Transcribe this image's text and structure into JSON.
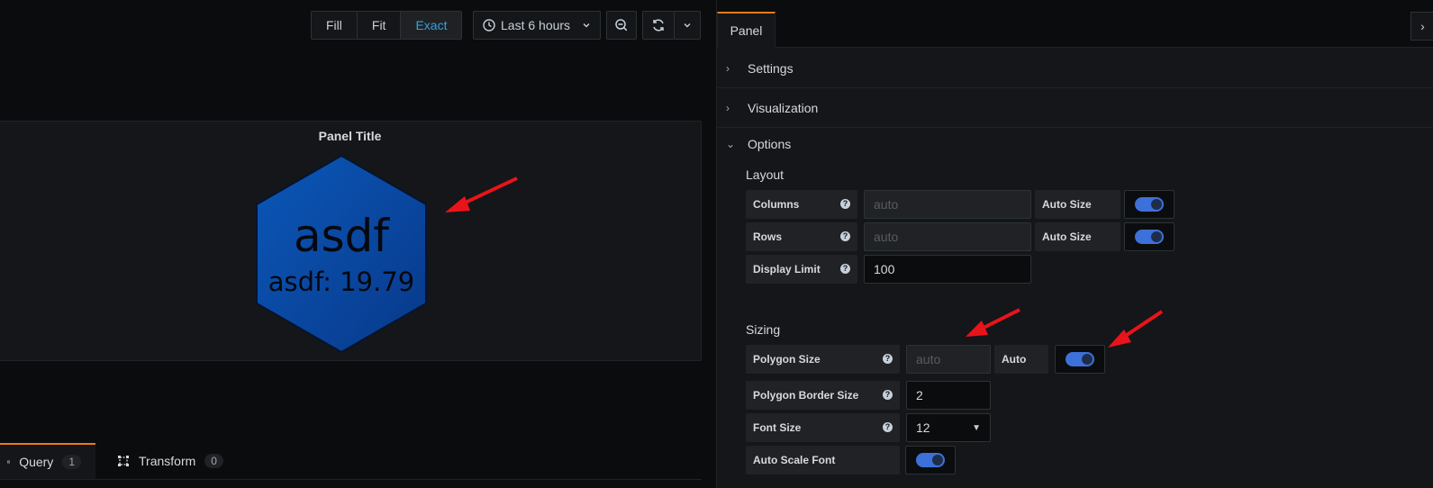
{
  "toolbar": {
    "fill_label": "Fill",
    "fit_label": "Fit",
    "exact_label": "Exact",
    "time_range": "Last 6 hours"
  },
  "panel": {
    "title": "Panel Title",
    "polygon_name": "asdf",
    "polygon_value": "asdf: 19.79",
    "polygon_color": "#0a4fa6"
  },
  "bottom_tabs": {
    "query_label": "Query",
    "query_count": "1",
    "transform_label": "Transform",
    "transform_count": "0"
  },
  "editor": {
    "tab_label": "Panel",
    "sections": {
      "settings": "Settings",
      "visualization": "Visualization",
      "options": "Options"
    },
    "layout": {
      "title": "Layout",
      "columns_label": "Columns",
      "columns_placeholder": "auto",
      "rows_label": "Rows",
      "rows_placeholder": "auto",
      "auto_size_label": "Auto Size",
      "display_limit_label": "Display Limit",
      "display_limit_value": "100"
    },
    "sizing": {
      "title": "Sizing",
      "polygon_size_label": "Polygon Size",
      "polygon_size_placeholder": "auto",
      "auto_label": "Auto",
      "border_size_label": "Polygon Border Size",
      "border_size_value": "2",
      "font_size_label": "Font Size",
      "font_size_value": "12",
      "auto_scale_font_label": "Auto Scale Font"
    }
  },
  "colors": {
    "accent_orange": "#eb7b18",
    "active_blue": "#33a2e5",
    "toggle_blue": "#3d71d9",
    "annotation_red": "#e8141a"
  }
}
